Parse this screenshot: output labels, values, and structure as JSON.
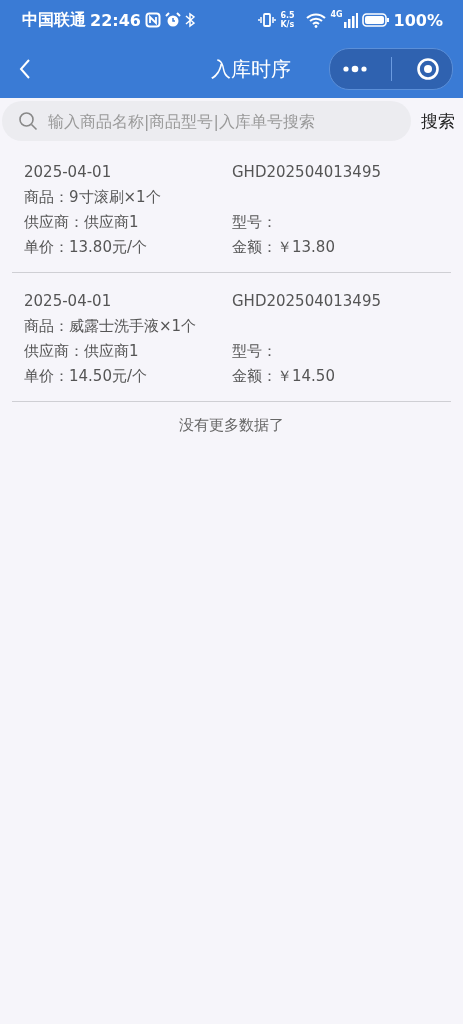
{
  "status_bar": {
    "carrier": "中国联通",
    "time": "22:46",
    "net_speed": "6.5 K/s",
    "network": "4G",
    "battery": "100%"
  },
  "nav": {
    "title": "入库时序"
  },
  "search": {
    "placeholder": "输入商品名称|商品型号|入库单号搜索",
    "button": "搜索"
  },
  "records": [
    {
      "date": "2025-04-01",
      "order_no": "GHD202504013495",
      "product": "商品：9寸滚刷×1个",
      "supplier": "供应商：供应商1",
      "model": "型号：",
      "unit_price": "单价：13.80元/个",
      "amount": "金额：￥13.80"
    },
    {
      "date": "2025-04-01",
      "order_no": "GHD202504013495",
      "product": "商品：威露士洗手液×1个",
      "supplier": "供应商：供应商1",
      "model": "型号：",
      "unit_price": "单价：14.50元/个",
      "amount": "金额：￥14.50"
    }
  ],
  "footer": "没有更多数据了"
}
